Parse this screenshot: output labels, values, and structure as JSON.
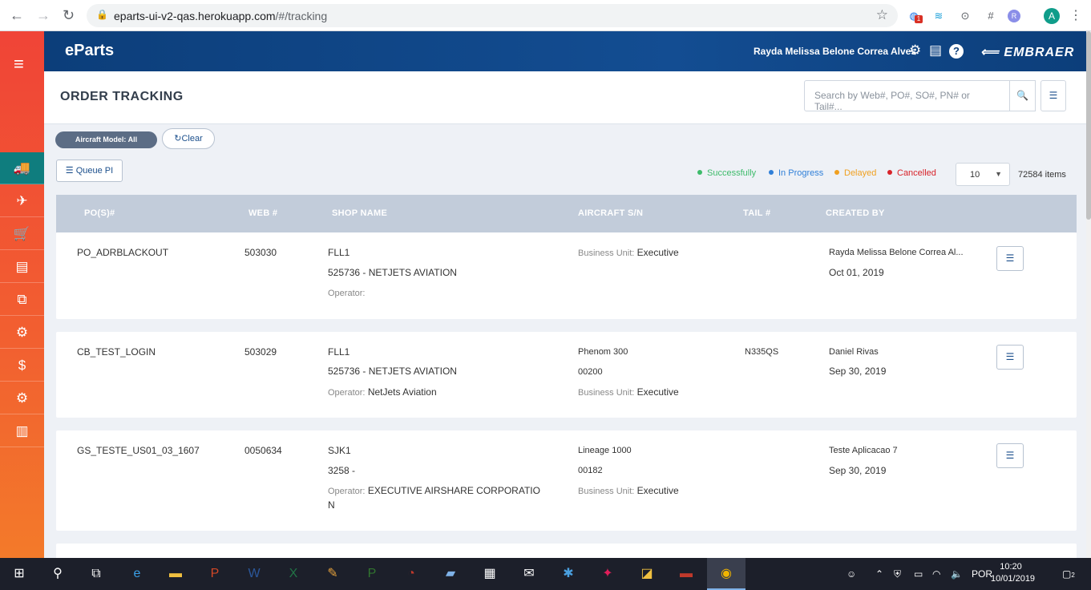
{
  "browser": {
    "back_icon": "arrow-left-icon",
    "forward_icon": "arrow-right-icon",
    "reload_icon": "reload-icon",
    "url_host": "eparts-ui-v2-qas.herokuapp.com",
    "url_path": "/#/tracking",
    "avatar_letter": "A",
    "ext_badge": "1",
    "ext_r": "R"
  },
  "sidebar": {
    "items": [
      {
        "icon": "truck-icon",
        "glyph": "🚚"
      },
      {
        "icon": "airplane-icon",
        "glyph": "✈"
      },
      {
        "icon": "cart-icon",
        "glyph": "🛒"
      },
      {
        "icon": "document-icon",
        "glyph": "▤"
      },
      {
        "icon": "package-icon",
        "glyph": "⧉"
      },
      {
        "icon": "truck-settings-icon",
        "glyph": "⚙"
      },
      {
        "icon": "dollar-icon",
        "glyph": "$"
      },
      {
        "icon": "gears-icon",
        "glyph": "⚙"
      },
      {
        "icon": "bar-chart-icon",
        "glyph": "▥"
      }
    ]
  },
  "topbar": {
    "logo": "eParts",
    "user": "Rayda Melissa Belone Correa Alves",
    "brand": "EMBRAER"
  },
  "page": {
    "title": "ORDER TRACKING",
    "search_placeholder": "Search by Web#, PO#, SO#, PN# or Tail#..."
  },
  "filters": {
    "aircraft_chip": "Aircraft Model: All",
    "clear_label": "Clear",
    "queue_label": "Queue PI"
  },
  "legend": [
    {
      "label": "Successfully",
      "color": "#3dbb6a"
    },
    {
      "label": "In Progress",
      "color": "#2f7fd8"
    },
    {
      "label": "Delayed",
      "color": "#f0a020"
    },
    {
      "label": "Cancelled",
      "color": "#d8232a"
    }
  ],
  "pager": {
    "page_size": "10",
    "items": "72584 items"
  },
  "table": {
    "headers": [
      "PO(S)#",
      "WEB #",
      "SHOP NAME",
      "AIRCRAFT S/N",
      "TAIL #",
      "CREATED BY"
    ],
    "labels": {
      "operator": "Operator:",
      "business_unit": "Business Unit:"
    },
    "rows": [
      {
        "po": "PO_ADRBLACKOUT",
        "web": "503030",
        "shop": "FLL1",
        "shop_detail": "525736 - NETJETS AVIATION",
        "operator": "",
        "aircraft": "",
        "serial": "",
        "business_unit": "Executive",
        "tail": "",
        "created_by": "Rayda Melissa Belone Correa Al...",
        "date": "Oct 01, 2019"
      },
      {
        "po": "CB_TEST_LOGIN",
        "web": "503029",
        "shop": "FLL1",
        "shop_detail": "525736 - NETJETS AVIATION",
        "operator": "NetJets Aviation",
        "aircraft": "Phenom 300",
        "serial": "00200",
        "business_unit": "Executive",
        "tail": "N335QS",
        "created_by": "Daniel Rivas",
        "date": "Sep 30, 2019"
      },
      {
        "po": "GS_TESTE_US01_03_1607",
        "web": "0050634",
        "shop": "SJK1",
        "shop_detail": "3258 -",
        "operator": "EXECUTIVE AIRSHARE CORPORATIO",
        "operator_wrap": "N",
        "aircraft": "Lineage 1000",
        "serial": "00182",
        "business_unit": "Executive",
        "tail": "",
        "created_by": "Teste Aplicacao 7",
        "date": "Sep 30, 2019"
      }
    ]
  },
  "taskbar": {
    "time": "10:20",
    "date": "10/01/2019",
    "lang": "POR",
    "notif": "2"
  }
}
